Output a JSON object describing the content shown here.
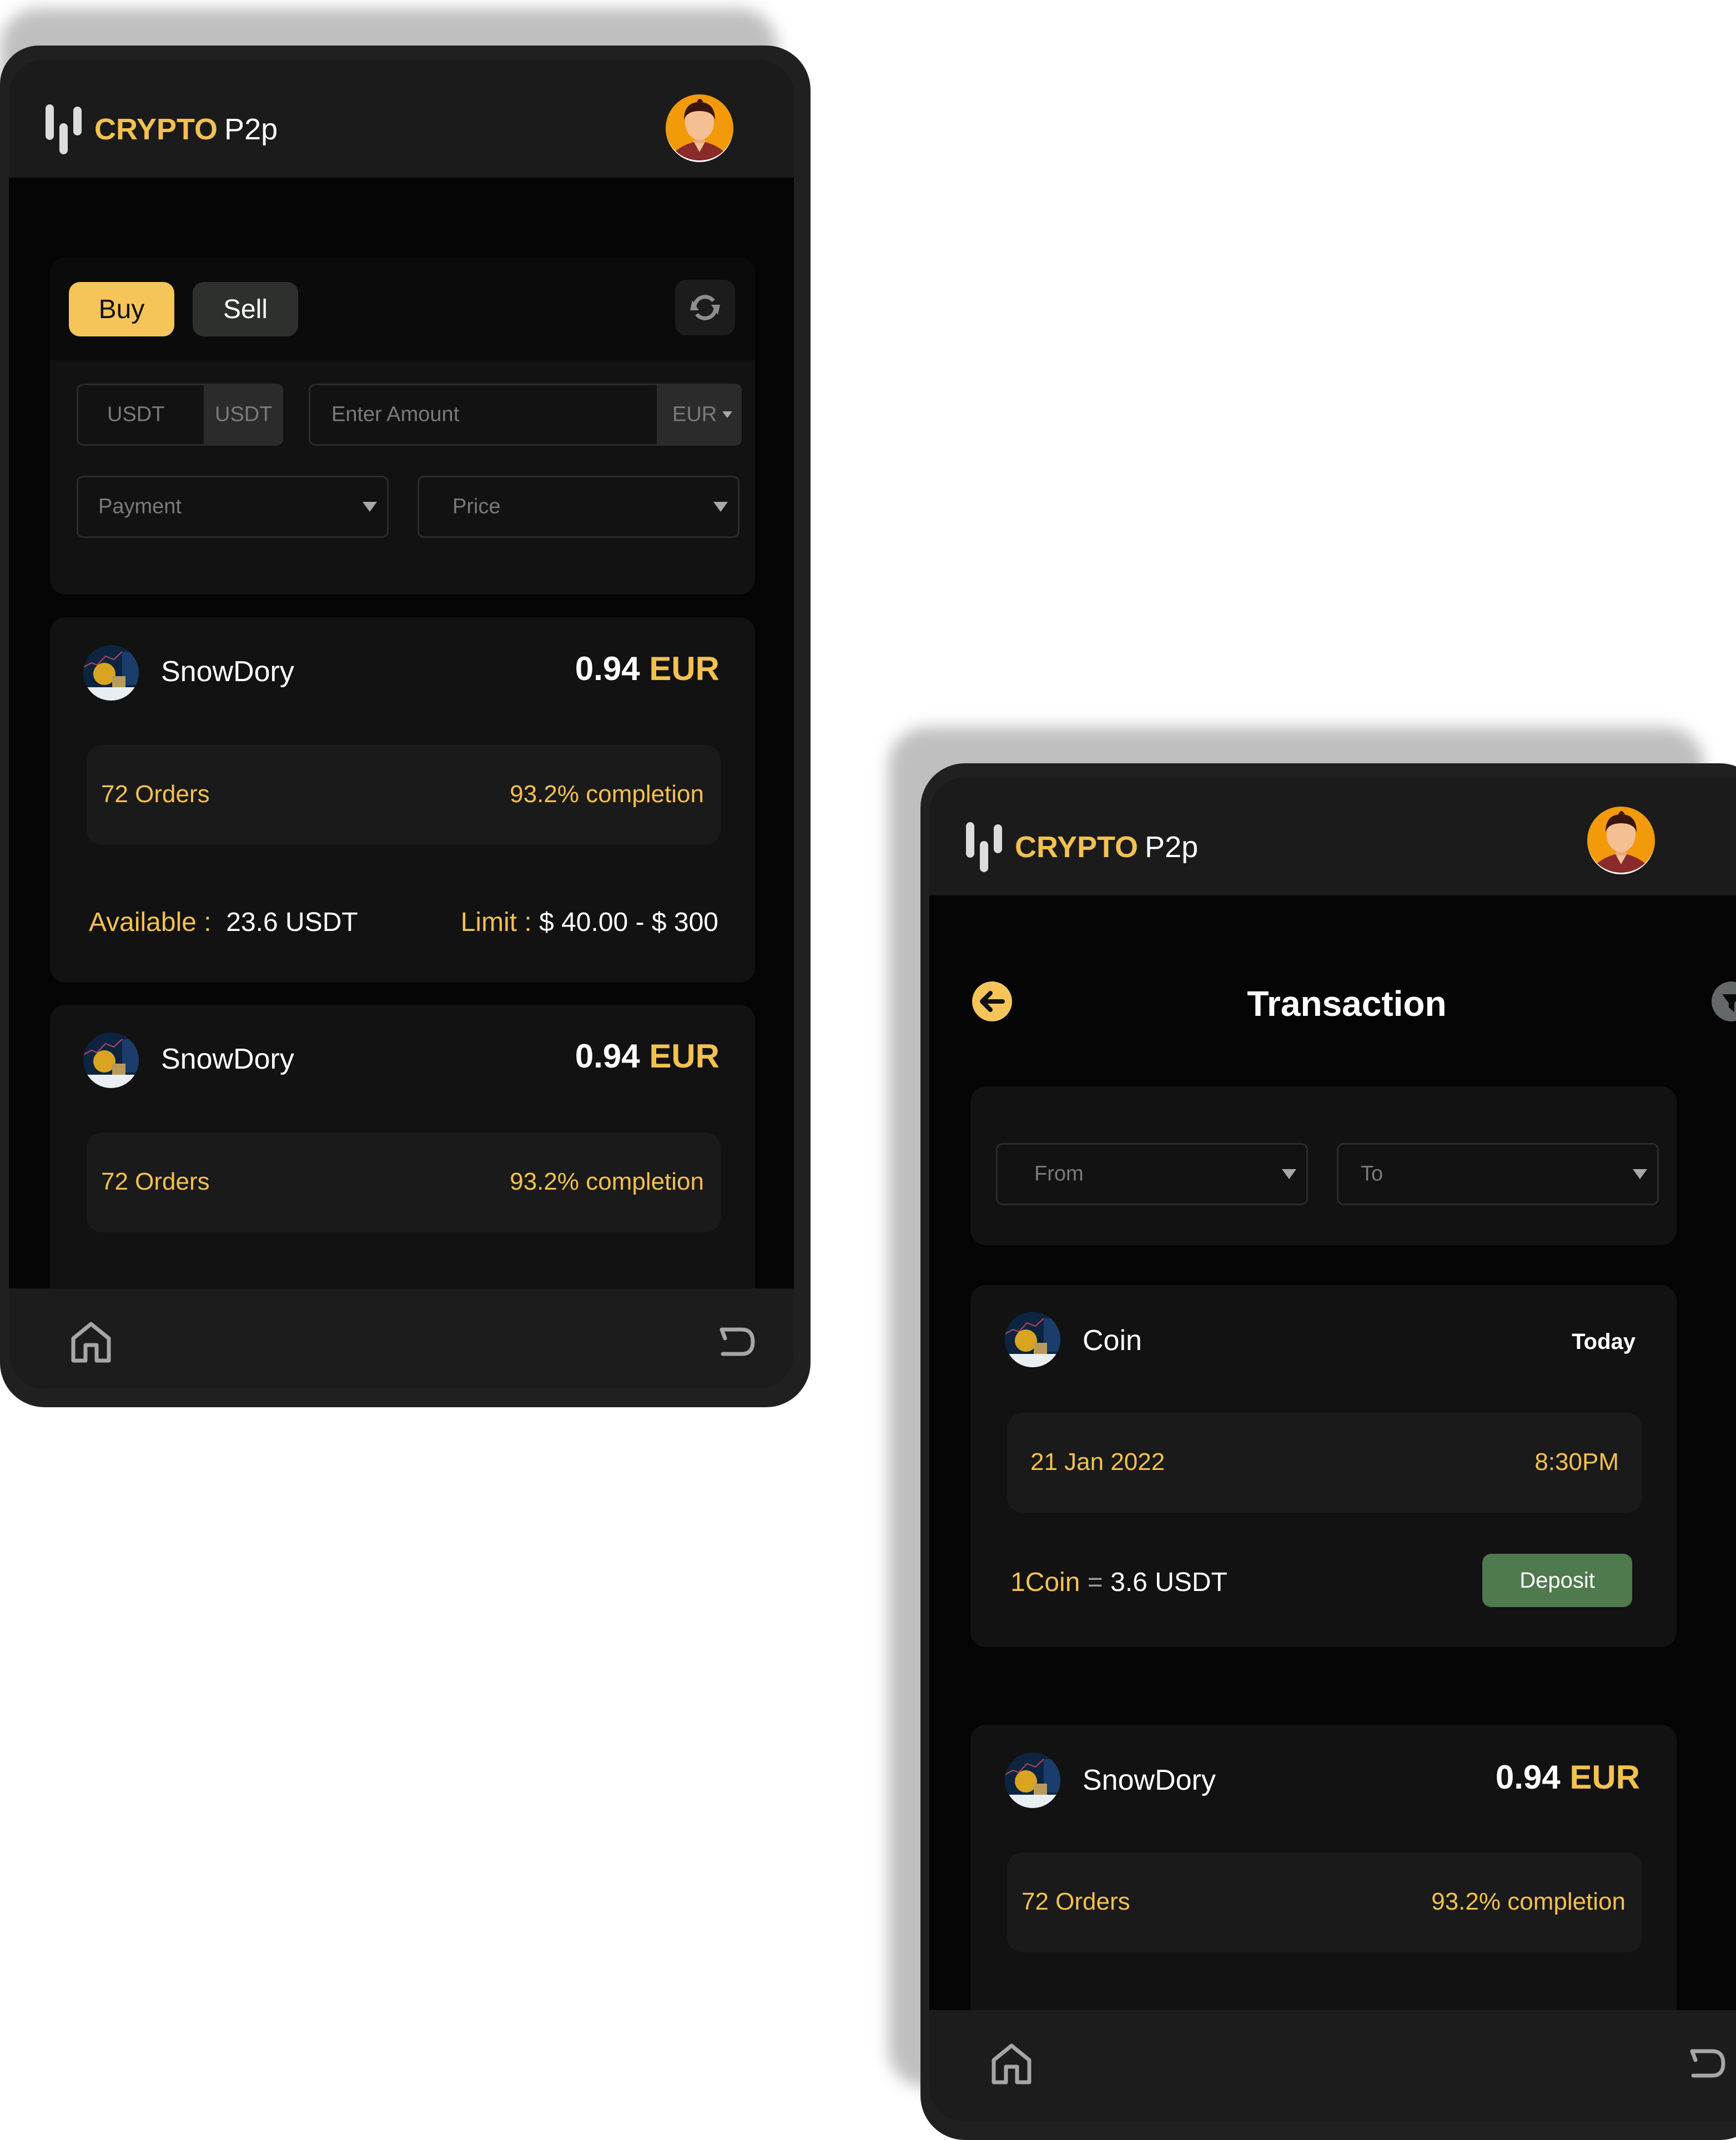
{
  "brand": {
    "name_accent": "CRYPTO",
    "name_rest": "P2p"
  },
  "colors": {
    "accent": "#f3c14f",
    "deposit": "#4e7a4e",
    "background": "#050505",
    "card": "#121212"
  },
  "left_screen": {
    "tabs": {
      "buy": "Buy",
      "sell": "Sell"
    },
    "refresh_icon": "refresh-icon",
    "crypto_field": {
      "value": "USDT",
      "suffix": "USDT"
    },
    "amount_field": {
      "placeholder": "Enter Amount",
      "currency": "EUR"
    },
    "payment_select": {
      "placeholder": "Payment"
    },
    "price_select": {
      "placeholder": "Price"
    },
    "offers": [
      {
        "seller": "SnowDory",
        "price": "0.94",
        "currency": "EUR",
        "orders": "72 Orders",
        "completion": "93.2% completion",
        "available_label": "Available :",
        "available_value": "23.6 USDT",
        "limit_label": "Limit :",
        "limit_value": "$ 40.00 - $ 300"
      },
      {
        "seller": "SnowDory",
        "price": "0.94",
        "currency": "EUR",
        "orders": "72 Orders",
        "completion": "93.2% completion"
      }
    ],
    "nav": {
      "home_icon": "home-icon",
      "back_icon": "back-icon"
    }
  },
  "right_screen": {
    "title": "Transaction",
    "back_icon": "arrow-left-icon",
    "filter_icon": "filter-icon",
    "from_select": {
      "placeholder": "From"
    },
    "to_select": {
      "placeholder": "To"
    },
    "transaction": {
      "name": "Coin",
      "day": "Today",
      "date": "21 Jan 2022",
      "time": "8:30PM",
      "rate_label": "1Coin",
      "rate_eq": "=",
      "rate_value": "3.6 USDT",
      "action": "Deposit"
    },
    "offer": {
      "seller": "SnowDory",
      "price": "0.94",
      "currency": "EUR",
      "orders": "72 Orders",
      "completion": "93.2% completion"
    },
    "nav": {
      "home_icon": "home-icon",
      "back_icon": "back-icon"
    }
  }
}
